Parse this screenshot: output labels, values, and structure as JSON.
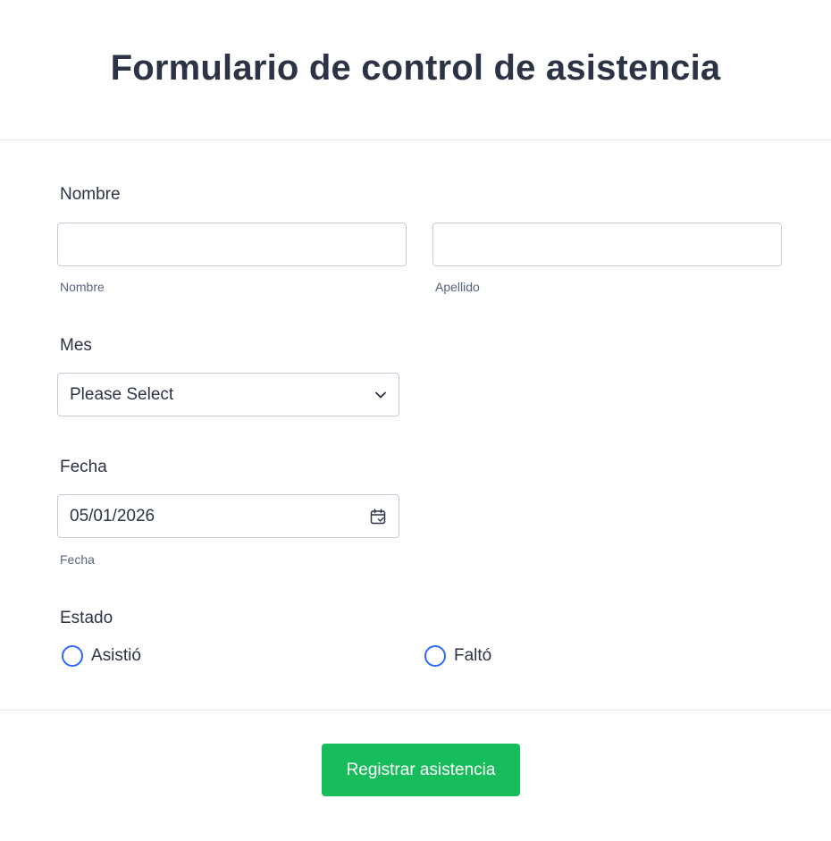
{
  "form": {
    "title": "Formulario de control de asistencia",
    "submit_label": "Registrar asistencia"
  },
  "fields": {
    "nombre": {
      "label": "Nombre",
      "first": {
        "value": "",
        "sublabel": "Nombre"
      },
      "last": {
        "value": "",
        "sublabel": "Apellido"
      }
    },
    "mes": {
      "label": "Mes",
      "selected": "Please Select",
      "icon": "chevron-down-icon"
    },
    "fecha": {
      "label": "Fecha",
      "value": "05/01/2026",
      "sublabel": "Fecha",
      "icon": "calendar-icon"
    },
    "estado": {
      "label": "Estado",
      "options": [
        {
          "label": "Asistió",
          "checked": false
        },
        {
          "label": "Faltó",
          "checked": false
        }
      ]
    }
  },
  "colors": {
    "text": "#2c3345",
    "sublabel": "#57647e",
    "border": "#c3cad8",
    "radio_accent": "#2e69ff",
    "submit_bg": "#18bd5b",
    "divider": "#e3e5ea"
  }
}
